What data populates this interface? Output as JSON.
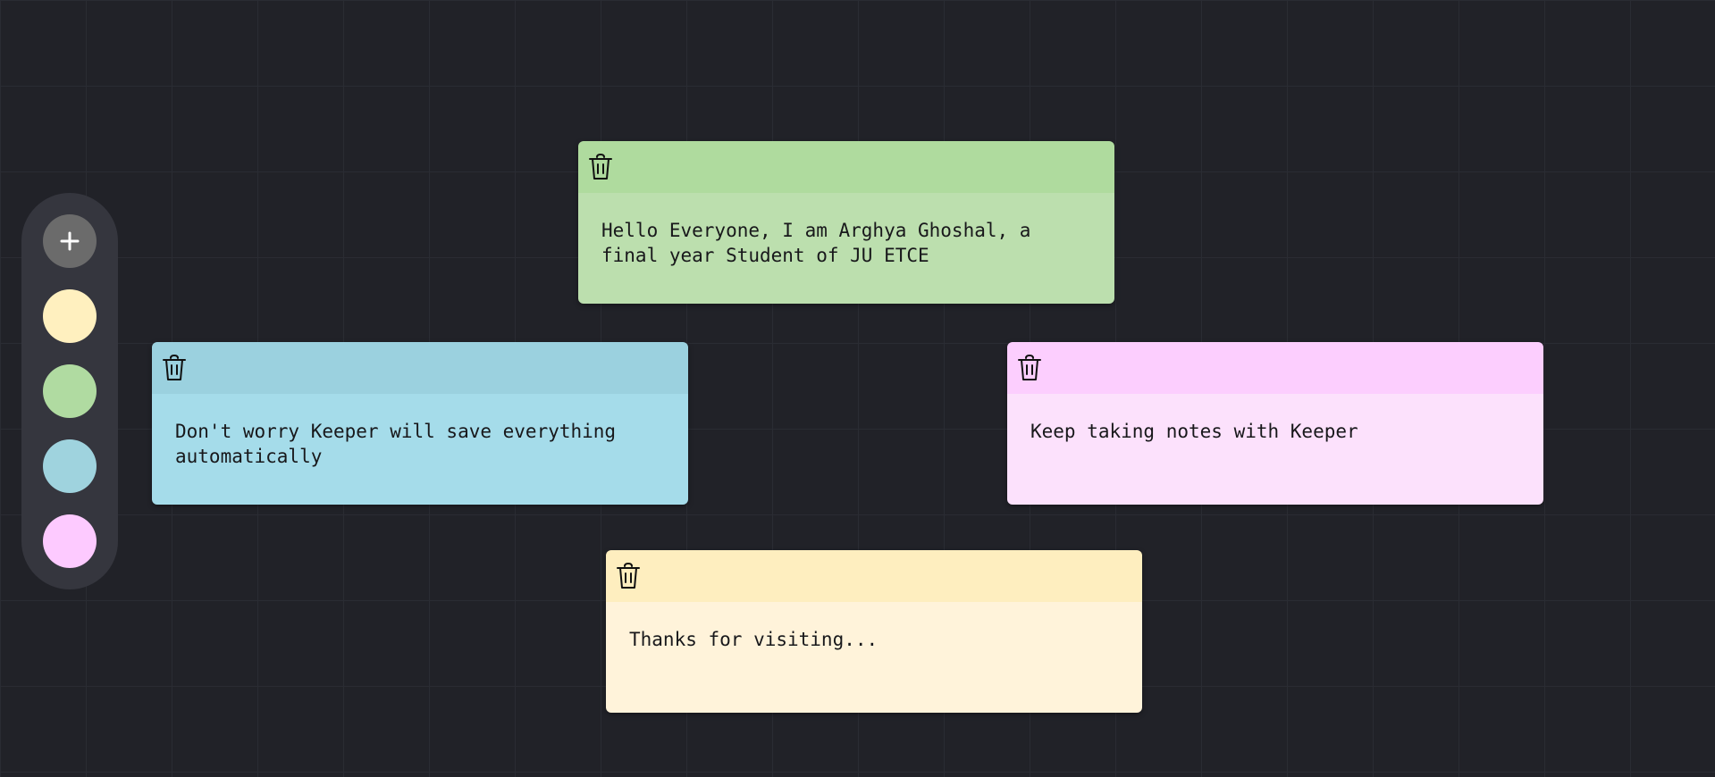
{
  "sidebar": {
    "add_icon": "plus-icon",
    "colors": [
      {
        "name": "yellow",
        "hex": "#fff0bf"
      },
      {
        "name": "green",
        "hex": "#b0dba1"
      },
      {
        "name": "blue",
        "hex": "#9fd3de"
      },
      {
        "name": "pink",
        "hex": "#fdcaff"
      }
    ]
  },
  "notes": [
    {
      "text": "Hello Everyone, I am Arghya Ghoshal, a final year Student of JU ETCE",
      "header_color": "#afdb9e",
      "body_color": "#bcdfae",
      "icon": "trash-icon"
    },
    {
      "text": "Don't worry Keeper will save everything automatically",
      "header_color": "#9bd1df",
      "body_color": "#a5dcea",
      "icon": "trash-icon"
    },
    {
      "text": "Keep taking notes with Keeper",
      "header_color": "#fccefe",
      "body_color": "#fce1fc",
      "icon": "trash-icon"
    },
    {
      "text": "Thanks for visiting...",
      "header_color": "#feeebf",
      "body_color": "#fff3da",
      "icon": "trash-icon"
    }
  ]
}
